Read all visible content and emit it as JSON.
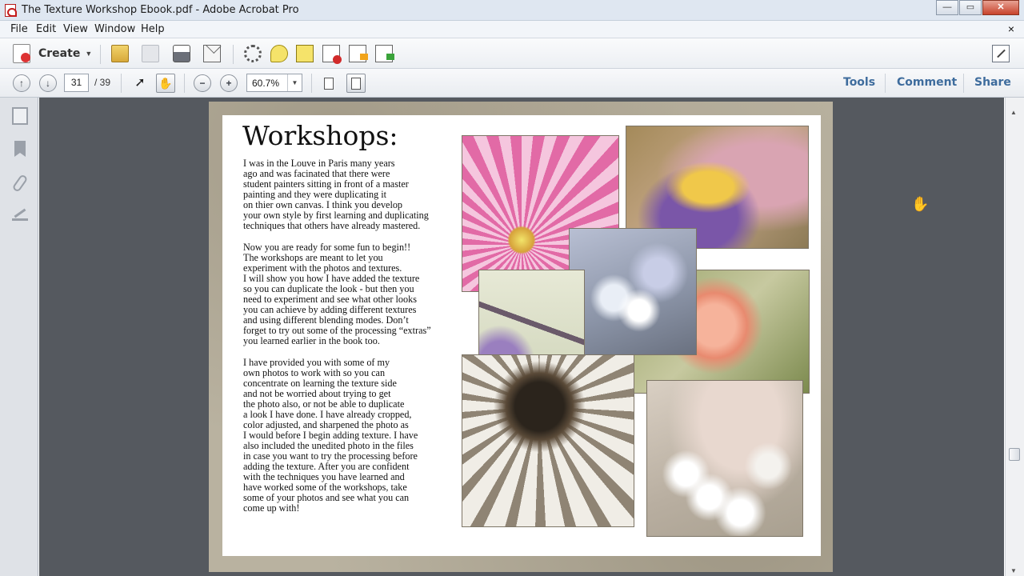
{
  "window": {
    "title": "The Texture Workshop Ebook.pdf - Adobe Acrobat Pro",
    "minimize": "—",
    "restore": "▭",
    "close": "✕"
  },
  "menu": {
    "items": [
      "File",
      "Edit",
      "View",
      "Window",
      "Help"
    ],
    "close_doc": "×"
  },
  "toolbar": {
    "create_label": "Create",
    "icons": [
      "open-icon",
      "save-icon",
      "print-icon",
      "email-icon",
      "settings-gear-icon",
      "comment-icon",
      "sign-icon",
      "redact-icon",
      "export-icon",
      "import-icon"
    ]
  },
  "nav": {
    "prev_page": "↑",
    "next_page": "↓",
    "current_page": "31",
    "total_pages": "/ 39",
    "zoom": "60.7%",
    "zoom_out": "−",
    "zoom_in": "+",
    "panes": [
      "Tools",
      "Comment",
      "Share"
    ]
  },
  "document": {
    "heading": "Workshops:",
    "paragraphs": [
      "I was in the Louve in Paris many years\nago and was facinated that there were\nstudent painters sitting in front of a master\npainting and they were duplicating it\non thier own canvas.  I think you develop\nyour own style by first learning and duplicating\ntechniques that others have already mastered.",
      "Now you are ready for some fun to begin!!\nThe workshops are meant to let you\nexperiment with the photos and textures.\nI will show you how I have added the texture\nso you can duplicate the look - but then you\nneed to experiment and see what other looks\nyou can achieve by adding different textures\nand using different blending modes.  Don’t\nforget to try out some of the processing “extras”\nyou learned earlier in the book too.",
      "I have provided you with some of my\nown photos to work with so you can\nconcentrate on learning the texture side\nand not be worried about trying to get\nthe photo also, or not be able to duplicate\na look I have done.  I have already cropped,\ncolor adjusted, and sharpened the photo as\nI would before I begin adding texture. I have\nalso included the unedited photo in the files\nin case you want to try the processing before\nadding the texture.  After you are confident\nwith the techniques you have learned and\nhave worked some of the workshops, take\nsome of your photos and see what you can\ncome up with!"
    ]
  },
  "colors": {
    "pane_tab": "#3e6c9d",
    "doc_background": "#55595f",
    "title_bar": "#dfe7f1"
  }
}
